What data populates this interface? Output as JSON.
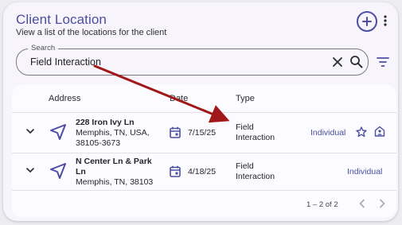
{
  "header": {
    "title": "Client Location",
    "subtitle": "View a list of the locations for the client"
  },
  "search": {
    "label": "Search",
    "value": "Field Interaction"
  },
  "table": {
    "columns": {
      "address": "Address",
      "date": "Date",
      "type": "Type"
    },
    "rows": [
      {
        "address_line1": "228 Iron Ivy Ln",
        "address_line2": "Memphis, TN, USA,",
        "address_line3": "38105-3673",
        "date": "7/15/25",
        "type_line1": "Field",
        "type_line2": "Interaction",
        "individual": "Individual"
      },
      {
        "address_line1": "N Center Ln & Park",
        "address_line2": "Ln",
        "address_line3": "Memphis, TN, 38103",
        "date": "4/18/25",
        "type_line1": "Field",
        "type_line2": "Interaction",
        "individual": "Individual"
      }
    ]
  },
  "pagination": {
    "range": "1 – 2 of 2"
  },
  "colors": {
    "accent": "#4b4ea1",
    "annotation_arrow": "#a01818"
  },
  "icons": {
    "add": "add-circle-icon",
    "more": "more-vert-icon",
    "clear": "close-icon",
    "search": "search-icon",
    "filter": "filter-icon",
    "expand": "chevron-down-icon",
    "navigation": "navigation-arrow-icon",
    "date": "calendar-icon",
    "favorite": "star-outline-icon",
    "home": "home-person-icon",
    "prev": "chevron-left-icon",
    "next": "chevron-right-icon"
  }
}
